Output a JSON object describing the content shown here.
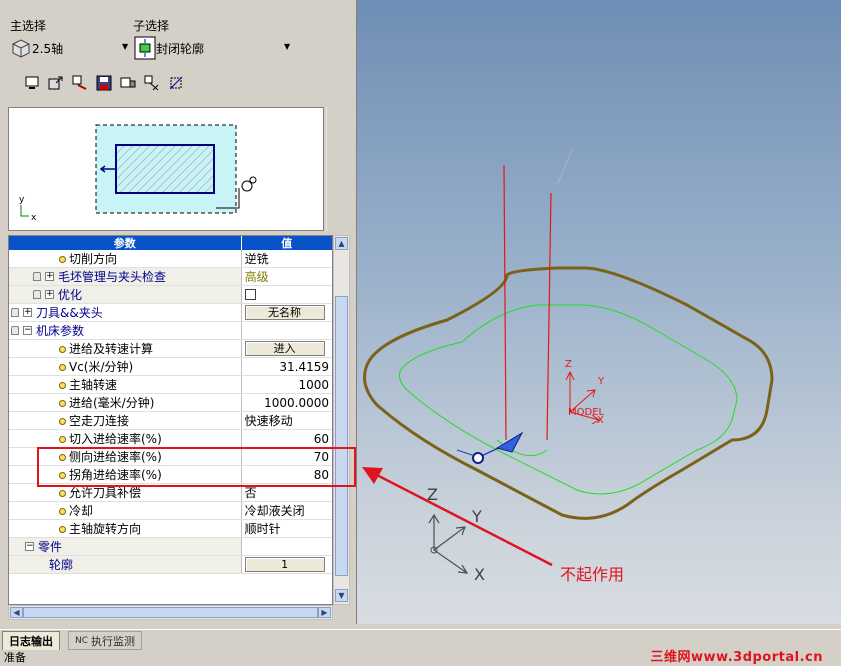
{
  "left_panel": {
    "main_select": {
      "label": "主选择",
      "value": "2.5轴"
    },
    "sub_select": {
      "label": "子选择",
      "value": "封闭轮廓"
    },
    "toolbar_icons": [
      "monitor-icon",
      "export-icon",
      "tool-setup-icon",
      "save-icon",
      "machine-icon",
      "edit-tool-icon",
      "path-icon"
    ]
  },
  "preview": {
    "axis_y": "y",
    "axis_x": "x"
  },
  "params": {
    "header": {
      "name": "参数",
      "value": "值"
    },
    "rows": [
      {
        "label": "切削方向",
        "value": "逆铣"
      },
      {
        "label": "毛坯管理与夹头检查",
        "value": "高级"
      },
      {
        "label": "优化",
        "value": ""
      },
      {
        "label": "刀具&&夹头",
        "value": "无名称"
      },
      {
        "label": "机床参数",
        "value": ""
      },
      {
        "label": "进给及转速计算",
        "value": "进入"
      },
      {
        "label": "Vc(米/分钟)",
        "value": "31.4159"
      },
      {
        "label": "主轴转速",
        "value": "1000"
      },
      {
        "label": "进给(毫米/分钟)",
        "value": "1000.0000"
      },
      {
        "label": "空走刀连接",
        "value": "快速移动"
      },
      {
        "label": "切入进给速率(%)",
        "value": "60"
      },
      {
        "label": "侧向进给速率(%)",
        "value": "70"
      },
      {
        "label": "拐角进给速率(%)",
        "value": "80"
      },
      {
        "label": "允许刀具补偿",
        "value": "否"
      },
      {
        "label": "冷却",
        "value": "冷却液关闭"
      },
      {
        "label": "主轴旋转方向",
        "value": "顺时针"
      },
      {
        "label": "零件",
        "value": ""
      },
      {
        "label": "轮廓",
        "value": "1"
      }
    ]
  },
  "viewport": {
    "model_label": "MODEL",
    "model_axes": {
      "z": "Z",
      "y": "Y",
      "x": "X"
    },
    "world_axes": {
      "z": "Z",
      "y": "Y",
      "x": "X"
    },
    "annotation": "不起作用"
  },
  "bottom": {
    "tab_log": "日志输出",
    "tab_nc_prefix": "NC",
    "tab_nc": "执行监测",
    "status": "准备",
    "watermark": "三维网www.3dportal.cn"
  },
  "colors": {
    "accent_red": "#e0141e",
    "header_blue": "#0a52c9",
    "toolpath_green": "#22dd22",
    "stock_brown": "#7a6218"
  }
}
